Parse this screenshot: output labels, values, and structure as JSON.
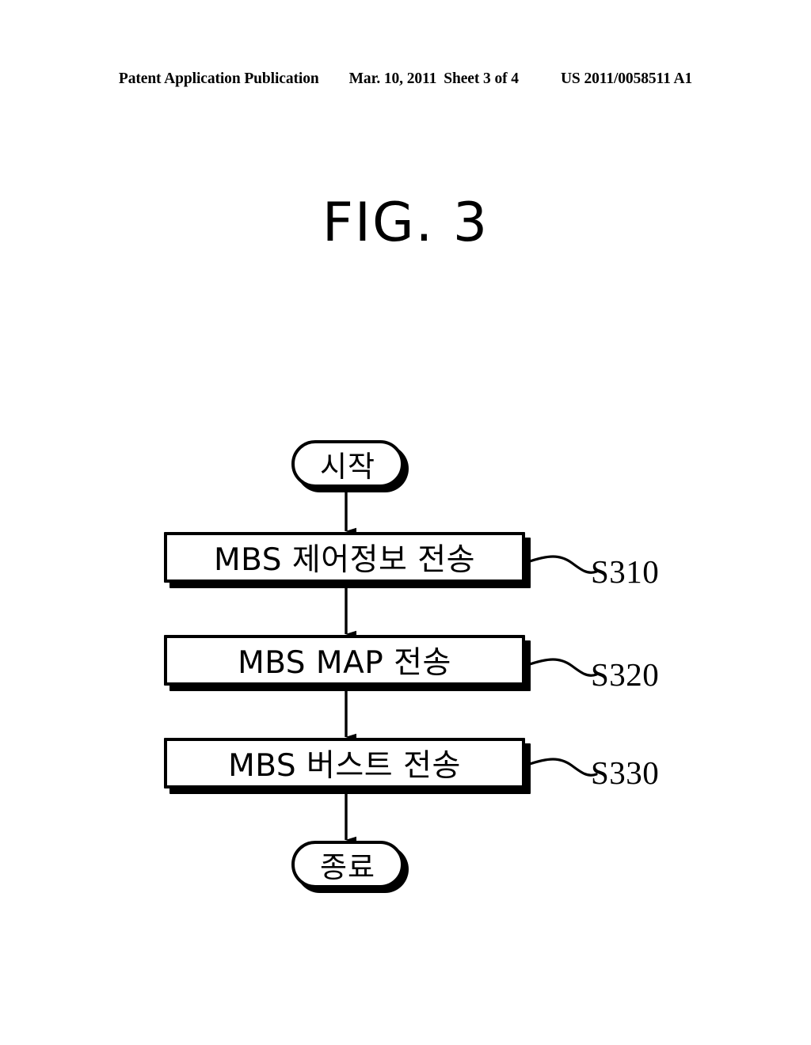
{
  "header": {
    "publication": "Patent Application Publication",
    "date": "Mar. 10, 2011",
    "sheet": "Sheet 3 of 4",
    "doc_number": "US 2011/0058511 A1"
  },
  "figure": {
    "title": "FIG. 3"
  },
  "flowchart": {
    "nodes": [
      {
        "id": "start",
        "shape": "terminal",
        "label": "시작",
        "ref": ""
      },
      {
        "id": "s310",
        "shape": "process",
        "label": "MBS 제어정보 전송",
        "ref": "S310"
      },
      {
        "id": "s320",
        "shape": "process",
        "label": "MBS MAP 전송",
        "ref": "S320"
      },
      {
        "id": "s330",
        "shape": "process",
        "label": "MBS 버스트 전송",
        "ref": "S330"
      },
      {
        "id": "end",
        "shape": "terminal",
        "label": "종료",
        "ref": ""
      }
    ],
    "edges": [
      {
        "from": "start",
        "to": "s310",
        "arrow": "down"
      },
      {
        "from": "s310",
        "to": "s320",
        "arrow": "down"
      },
      {
        "from": "s320",
        "to": "s330",
        "arrow": "down"
      },
      {
        "from": "s330",
        "to": "end",
        "arrow": "down"
      }
    ],
    "leaders": [
      {
        "node": "s310",
        "ref": "S310",
        "style": "squiggle"
      },
      {
        "node": "s320",
        "ref": "S320",
        "style": "squiggle"
      },
      {
        "node": "s330",
        "ref": "S330",
        "style": "squiggle"
      }
    ]
  },
  "colors": {
    "background": "#ffffff",
    "ink": "#000000",
    "shadow": "#000000"
  }
}
